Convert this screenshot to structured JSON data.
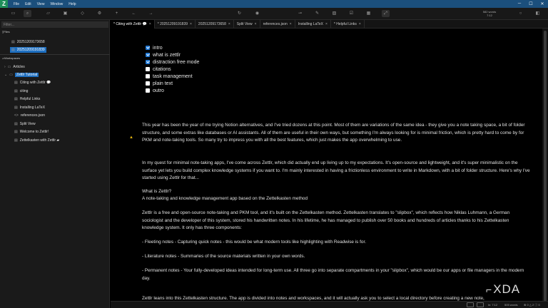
{
  "menu": [
    "File",
    "Edit",
    "View",
    "Window",
    "Help"
  ],
  "app_logo": "Z",
  "word_count": {
    "line1": "582 words",
    "line2": "7:12"
  },
  "sidebar": {
    "filter_placeholder": "Filter...",
    "files_heading": "Files",
    "files": [
      "20251209173658",
      "20251209191839"
    ],
    "workspaces_heading": "Workspaces",
    "tree": [
      {
        "label": "Articles",
        "kind": "folder-collapsed"
      },
      {
        "label": "Zettlr Tutorial",
        "kind": "folder-open"
      },
      {
        "label": "Citing with Zettlr",
        "kind": "file",
        "badge": "💬"
      },
      {
        "label": "citing",
        "kind": "file"
      },
      {
        "label": "Helpful Links",
        "kind": "file"
      },
      {
        "label": "Installing LaTeX",
        "kind": "file"
      },
      {
        "label": "references.json",
        "kind": "code"
      },
      {
        "label": "Split View",
        "kind": "file"
      },
      {
        "label": "Welcome to Zettlr!",
        "kind": "file"
      },
      {
        "label": "Zettelkasten with Zettlr",
        "kind": "file",
        "badge": "▰"
      }
    ]
  },
  "tabs": [
    {
      "label": "* Citing with Zettlr",
      "badge": "💬"
    },
    {
      "label": "* 20251209191839"
    },
    {
      "label": "20251209173658"
    },
    {
      "label": "Split View"
    },
    {
      "label": "references.json"
    },
    {
      "label": "Installing LaTeX"
    },
    {
      "label": "* Helpful Links"
    }
  ],
  "tasks": [
    {
      "label": "intro",
      "checked": true
    },
    {
      "label": "what is zettlr",
      "checked": true
    },
    {
      "label": "distraction free mode",
      "checked": true
    },
    {
      "label": "citations",
      "checked": false
    },
    {
      "label": "task management",
      "checked": false
    },
    {
      "label": "plain text",
      "checked": false
    },
    {
      "label": "outro",
      "checked": false
    }
  ],
  "paragraphs": [
    "This year has been the year of me trying Notion alternatives, and I've tried dozens at this point. Most of them are variations of the same idea - they give you a note taking space, a bit of folder structure, and some extras like databases or AI assistants. All of them are useful in their own ways, but something I'm always looking for is minimal friction, which is pretty hard to come by for PKM and note-taking tools. So many try to impress you with all the best features, which just makes the app overwhelming to use.",
    "In my quest for minimal note-taking apps, I've come across Zettlr, which did actually end up living up to my expectations. It's open-source and lightweight, and it's super minimalistic on the surface yet lets you build complex knowledge systems if you want to. I'm mainly interested in having a frictionless environment to write in Markdown, with a bit of folder structure. Here's why I've started using Zettlr for that...",
    "What is Zettlr?",
    "A note-taking and knowledge management app based on the Zettelkasten method",
    "Zettlr is a free and open-source note-taking and PKM tool, and it's built on the Zettelkasten method. Zettelkasten translates to \"slipbox\", which reflects how Niklas Luhmann, a German sociologist and the developer of this system, stored his handwritten notes. In his lifetime, he has managed to publish over 50 books and hundreds of articles thanks to his Zettelkasten knowledge system. It only has three components:",
    "- Fleeting notes - Capturing quick notes - this would be what modern tools like highlighting with Readwise is for.",
    "- Literature notes - Summaries of the source materials written in your own words.",
    "- Permanent notes - Your fully-developed ideas intended for long-term use. All three go into separate compartments in your \"slipbox\", which would be our apps or file managers in the modern day.",
    "Zettlr leans into this Zettelkasten structure. The app is divided into notes and workspaces, and it will actually ask you to select a local directory before creating a new note,"
  ],
  "status": {
    "position": "ln: 7:12",
    "words": "505 words",
    "errors": "0",
    "warnings": "2",
    "info": "0"
  },
  "watermark": "XDA",
  "colors": {
    "titlebar": "#1b4f7c",
    "selection": "#1e6fc0",
    "checkbox": "#1e78d6"
  }
}
